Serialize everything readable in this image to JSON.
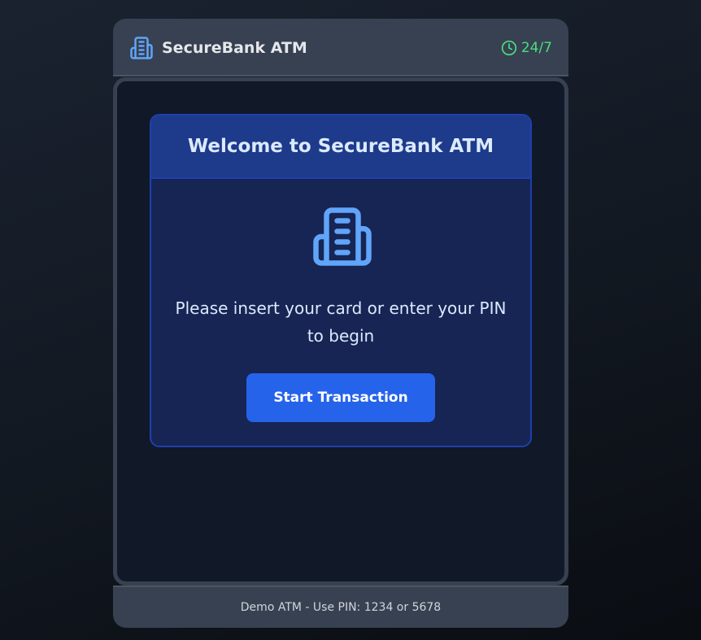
{
  "header": {
    "brand_icon": "bank-building-icon",
    "title": "SecureBank ATM",
    "status_icon": "clock-icon",
    "status_text": "24/7",
    "status_color": "#4ade80"
  },
  "welcome": {
    "title": "Welcome to SecureBank ATM",
    "icon": "bank-building-icon",
    "prompt": "Please insert your card or enter your PIN to begin",
    "start_button": "Start Transaction"
  },
  "footer": {
    "text": "Demo ATM - Use PIN: 1234 or 5678"
  },
  "colors": {
    "accent": "#2563eb",
    "icon_blue": "#60a5fa",
    "card_bg": "#172554",
    "card_header_bg": "#1e3a8a",
    "frame": "#374151"
  }
}
